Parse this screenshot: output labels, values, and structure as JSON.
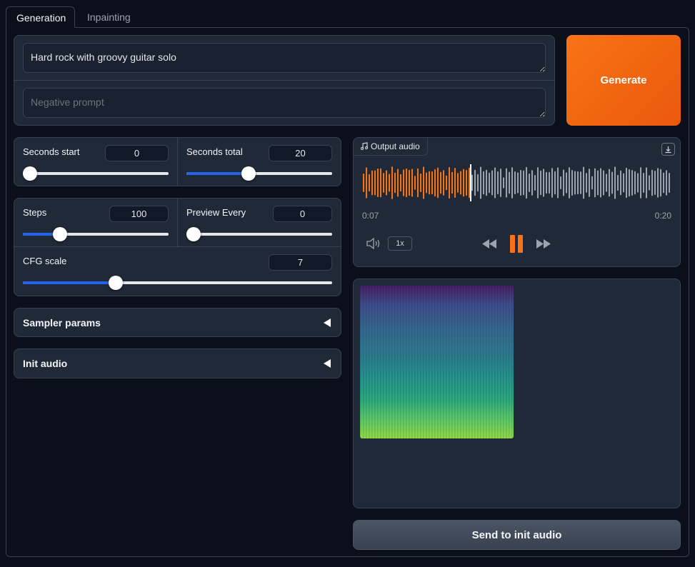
{
  "tabs": [
    "Generation",
    "Inpainting"
  ],
  "prompt": {
    "value": "Hard rock with groovy guitar solo",
    "negative_placeholder": "Negative prompt"
  },
  "generate_label": "Generate",
  "sliders": {
    "seconds_start": {
      "label": "Seconds start",
      "value": "0",
      "fraction": 0.0
    },
    "seconds_total": {
      "label": "Seconds total",
      "value": "20",
      "fraction": 0.42
    },
    "steps": {
      "label": "Steps",
      "value": "100",
      "fraction": 0.23
    },
    "preview_every": {
      "label": "Preview Every",
      "value": "0",
      "fraction": 0.0
    },
    "cfg_scale": {
      "label": "CFG scale",
      "value": "7",
      "fraction": 0.29
    }
  },
  "accordions": {
    "sampler": "Sampler params",
    "init_audio": "Init audio"
  },
  "audio": {
    "label": "Output audio",
    "current_time": "0:07",
    "duration": "0:20",
    "speed": "1x",
    "played_fraction": 0.35,
    "played_color": "#f97316",
    "unplayed_color": "#9ca3af"
  },
  "send_label": "Send to init audio",
  "icons": [
    "music-note-icon",
    "download-icon",
    "volume-icon",
    "rewind-icon",
    "pause-icon",
    "fast-forward-icon",
    "collapse-caret-icon"
  ]
}
